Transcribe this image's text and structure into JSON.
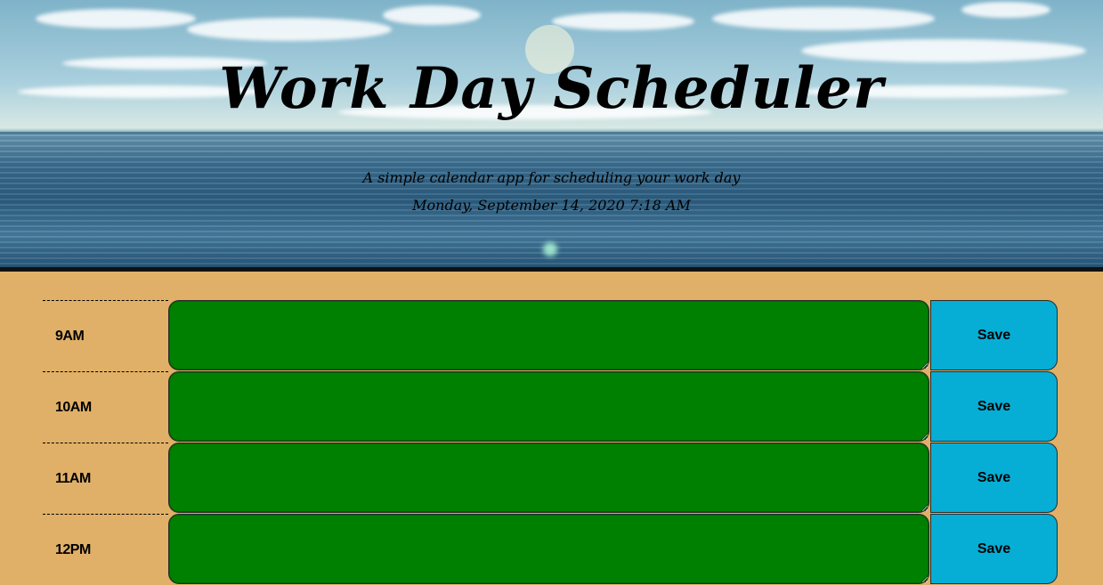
{
  "header": {
    "title": "Work Day Scheduler",
    "lead": "A simple calendar app for scheduling your work day",
    "current_day": "Monday, September 14, 2020 7:18 AM"
  },
  "time_blocks": [
    {
      "hour": "9AM",
      "description": "",
      "save_label": "Save",
      "status_color": "#008000"
    },
    {
      "hour": "10AM",
      "description": "",
      "save_label": "Save",
      "status_color": "#008000"
    },
    {
      "hour": "11AM",
      "description": "",
      "save_label": "Save",
      "status_color": "#008000"
    },
    {
      "hour": "12PM",
      "description": "",
      "save_label": "Save",
      "status_color": "#008000"
    }
  ],
  "colors": {
    "page_background": "#e0b068",
    "future": "#008000",
    "save_button": "#06aed5"
  }
}
